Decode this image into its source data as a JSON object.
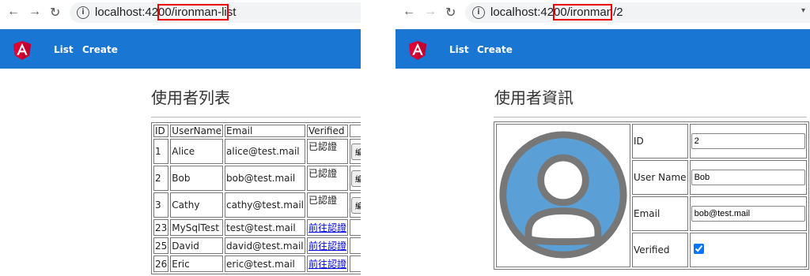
{
  "left": {
    "url_host": "localhost:4200",
    "url_path": "/ironman-list",
    "nav": {
      "list": "List",
      "create": "Create"
    },
    "title": "使用者列表",
    "table": {
      "headers": [
        "ID",
        "UserName",
        "Email",
        "Verified",
        ""
      ],
      "edit_label": "編輯",
      "rows": [
        {
          "id": "1",
          "name": "Alice",
          "email": "alice@test.mail",
          "verified": "已認證",
          "verified_link": false,
          "editable": true
        },
        {
          "id": "2",
          "name": "Bob",
          "email": "bob@test.mail",
          "verified": "已認證",
          "verified_link": false,
          "editable": true
        },
        {
          "id": "3",
          "name": "Cathy",
          "email": "cathy@test.mail",
          "verified": "已認證",
          "verified_link": false,
          "editable": true
        },
        {
          "id": "23",
          "name": "MySqlTest",
          "email": "test@test.mail",
          "verified": "前往認證",
          "verified_link": true,
          "editable": false
        },
        {
          "id": "25",
          "name": "David",
          "email": "david@test.mail",
          "verified": "前往認證",
          "verified_link": true,
          "editable": false
        },
        {
          "id": "26",
          "name": "Eric",
          "email": "eric@test.mail",
          "verified": "前往認證",
          "verified_link": true,
          "editable": false
        }
      ]
    }
  },
  "right": {
    "url_host": "localhost:4200",
    "url_path": "/ironman/2",
    "nav": {
      "list": "List",
      "create": "Create"
    },
    "title": "使用者資訊",
    "fields": {
      "id_label": "ID",
      "id_value": "2",
      "name_label": "User Name",
      "name_value": "Bob",
      "email_label": "Email",
      "email_value": "bob@test.mail",
      "verified_label": "Verified",
      "verified_checked": true
    }
  },
  "colors": {
    "appbar": "#1976d2",
    "angular_red": "#dd0031",
    "highlight": "#ee0000",
    "avatar_bg": "#5aa0d6",
    "avatar_stroke": "#777777"
  }
}
